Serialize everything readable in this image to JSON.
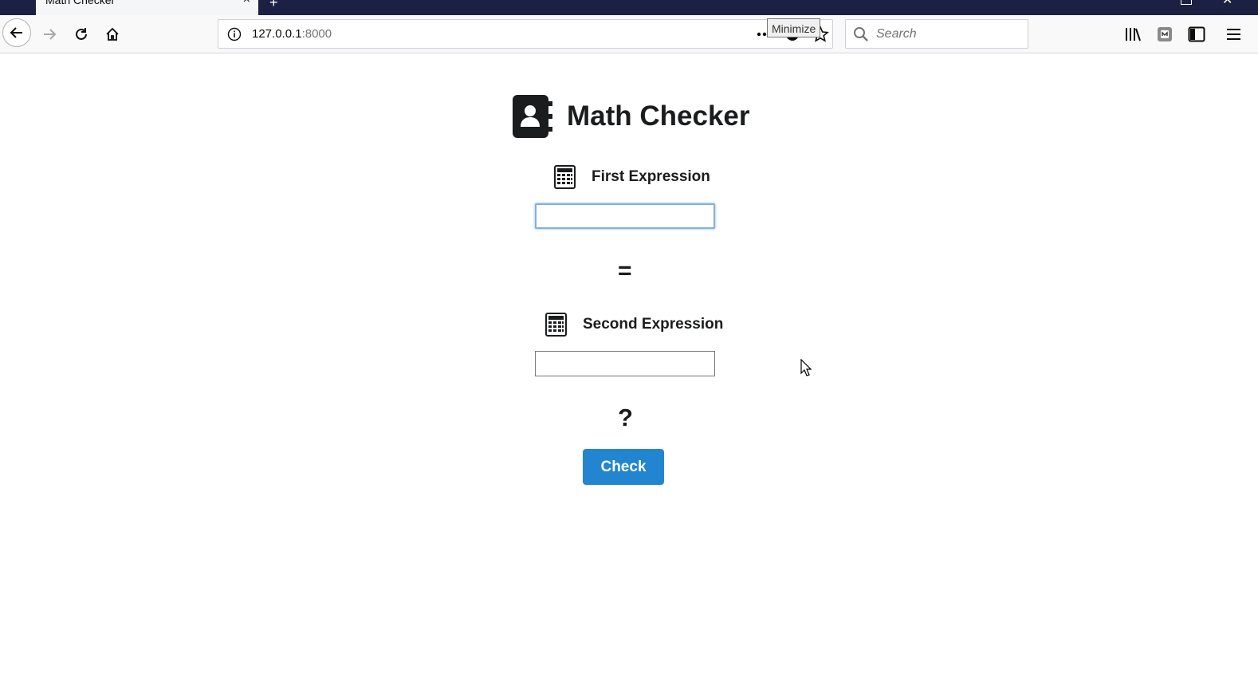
{
  "browser": {
    "tab_title": "Math Checker",
    "tab_close": "×",
    "new_tab": "+",
    "url_host": "127.0.0.1",
    "url_port": ":8000",
    "search_placeholder": "Search",
    "tooltip": "Minimize",
    "icons": [
      "back-arrow-icon",
      "forward-arrow-icon",
      "reload-icon",
      "home-icon",
      "info-icon",
      "more-icon",
      "pocket-icon",
      "bookmark-star-icon",
      "search-icon",
      "library-icon",
      "extension-icon",
      "sidebar-icon",
      "menu-icon"
    ]
  },
  "page": {
    "title": "Math Checker",
    "first_label": "First Expression",
    "first_value": "",
    "equals": "=",
    "second_label": "Second Expression",
    "second_value": "",
    "result": "?",
    "check_label": "Check",
    "accent_color": "#2185d0"
  }
}
